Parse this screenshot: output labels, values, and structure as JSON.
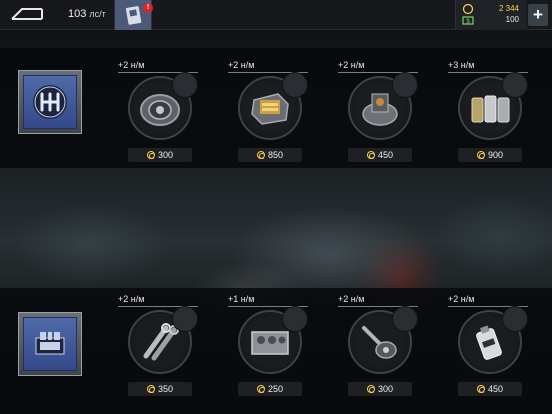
{
  "topbar": {
    "power_value": "103",
    "power_unit": "лс/т",
    "notification_count": "!",
    "currency_gold": "2 344",
    "currency_cash": "100",
    "add_label": "+"
  },
  "rows": [
    {
      "category_icon": "gearbox-icon",
      "parts": [
        {
          "bonus": "+2 н/м",
          "price": "300",
          "icon": "flywheel-part-icon"
        },
        {
          "bonus": "+2 н/м",
          "price": "850",
          "icon": "gearbox-housing-part-icon"
        },
        {
          "bonus": "+2 н/м",
          "price": "450",
          "icon": "clutch-part-icon"
        },
        {
          "bonus": "+3 н/м",
          "price": "900",
          "icon": "piston-set-part-icon"
        }
      ]
    },
    {
      "category_icon": "engine-block-icon",
      "parts": [
        {
          "bonus": "+2 н/м",
          "price": "350",
          "icon": "connecting-rods-part-icon"
        },
        {
          "bonus": "+1 н/м",
          "price": "250",
          "icon": "engine-block-part-icon"
        },
        {
          "bonus": "+2 н/м",
          "price": "300",
          "icon": "crankshaft-part-icon"
        },
        {
          "bonus": "+2 н/м",
          "price": "450",
          "icon": "oil-filter-part-icon"
        }
      ]
    }
  ],
  "colors": {
    "accent_blue": "#4f6aa8",
    "gold": "#ffd24a",
    "badge_red": "#d6262a"
  }
}
